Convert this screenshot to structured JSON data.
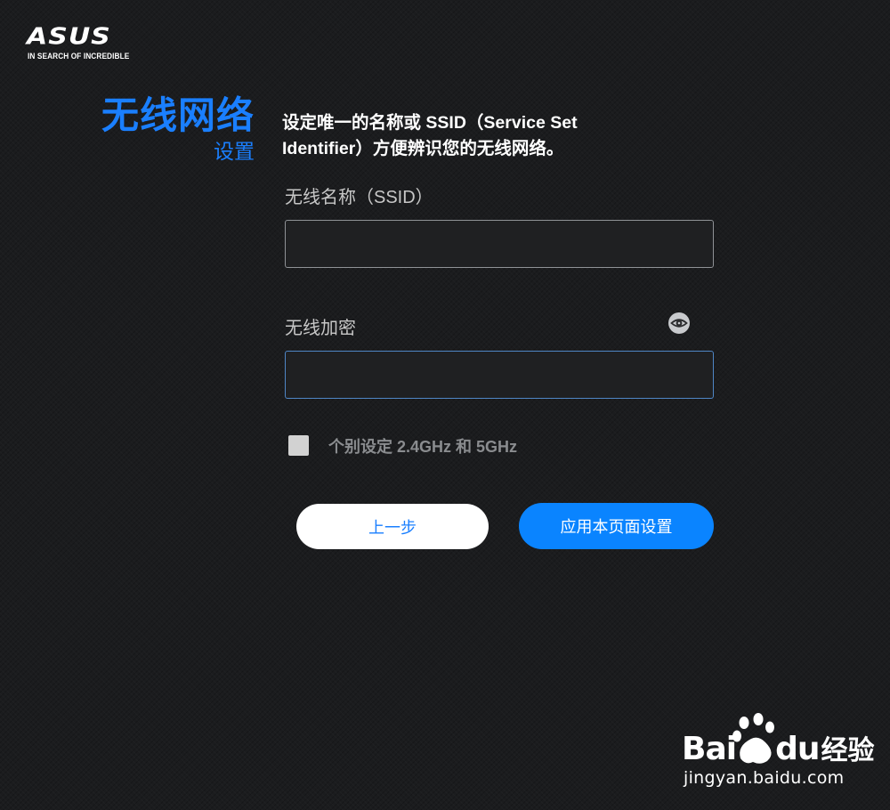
{
  "brand": {
    "logo_text": "ASUS",
    "tagline": "IN SEARCH OF INCREDIBLE"
  },
  "sidebar": {
    "title": "无线网络",
    "subtitle": "设置"
  },
  "main": {
    "description": "设定唯一的名称或 SSID（Service Set Identifier）方便辨识您的无线网络。",
    "ssid_field": {
      "label": "无线名称（SSID）",
      "value": ""
    },
    "key_field": {
      "label": "无线加密",
      "value": ""
    },
    "separate_bands": {
      "label": "个别设定 2.4GHz 和 5GHz",
      "checked": false
    },
    "buttons": {
      "back_label": "上一步",
      "apply_label": "应用本页面设置"
    }
  },
  "watermark": {
    "brand_left": "Bai",
    "brand_right": "du",
    "suffix": "经验",
    "domain": "jingyan.baidu.com"
  },
  "colors": {
    "accent": "#1a7fff",
    "button_primary": "#0a84ff",
    "background": "#1b1c1e"
  },
  "icons": {
    "show_password": "eye-icon",
    "watermark": "baidu-paw-icon"
  }
}
